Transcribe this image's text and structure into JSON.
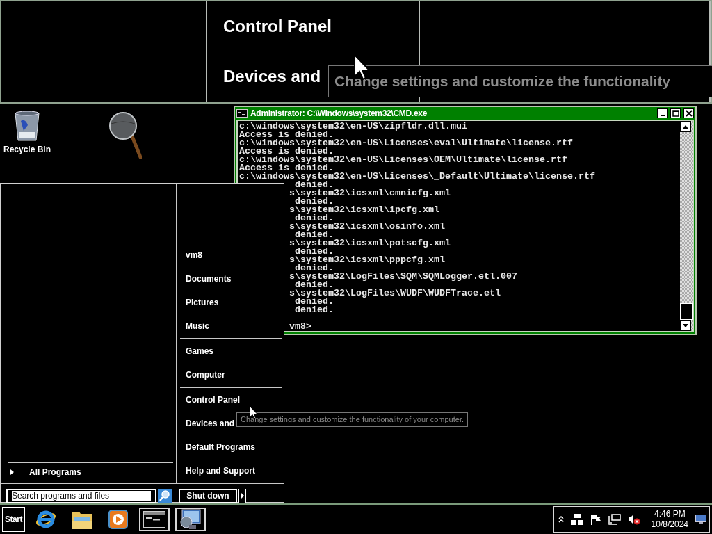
{
  "magnifier": {
    "items": [
      "Control Panel",
      "Devices and"
    ],
    "tooltip": "Change settings and customize the functionality"
  },
  "desktop_icons": [
    {
      "kind": "recycle-bin",
      "label": "Recycle Bin"
    },
    {
      "kind": "magnifier"
    }
  ],
  "cmd_window": {
    "title": "Administrator: C:\\Windows\\system32\\CMD.exe",
    "lines": [
      {
        "kind": "full",
        "text": "c:\\windows\\system32\\en-US\\zipfldr.dll.mui"
      },
      {
        "kind": "full",
        "text": "Access is denied."
      },
      {
        "kind": "full",
        "text": "c:\\windows\\system32\\en-US\\Licenses\\eval\\Ultimate\\license.rtf"
      },
      {
        "kind": "full",
        "text": "Access is denied."
      },
      {
        "kind": "full",
        "text": "c:\\windows\\system32\\en-US\\Licenses\\OEM\\Ultimate\\license.rtf"
      },
      {
        "kind": "full",
        "text": "Access is denied."
      },
      {
        "kind": "full",
        "text": "c:\\windows\\system32\\en-US\\Licenses\\_Default\\Ultimate\\license.rtf"
      },
      {
        "kind": "clipped",
        "text": " denied."
      },
      {
        "kind": "clipped",
        "text": "s\\system32\\icsxml\\cmnicfg.xml"
      },
      {
        "kind": "clipped",
        "text": " denied."
      },
      {
        "kind": "clipped",
        "text": "s\\system32\\icsxml\\ipcfg.xml"
      },
      {
        "kind": "clipped",
        "text": " denied."
      },
      {
        "kind": "clipped",
        "text": "s\\system32\\icsxml\\osinfo.xml"
      },
      {
        "kind": "clipped",
        "text": " denied."
      },
      {
        "kind": "clipped",
        "text": "s\\system32\\icsxml\\potscfg.xml"
      },
      {
        "kind": "clipped",
        "text": " denied."
      },
      {
        "kind": "clipped",
        "text": "s\\system32\\icsxml\\pppcfg.xml"
      },
      {
        "kind": "clipped",
        "text": " denied."
      },
      {
        "kind": "clipped",
        "text": "s\\system32\\LogFiles\\SQM\\SQMLogger.etl.007"
      },
      {
        "kind": "clipped",
        "text": " denied."
      },
      {
        "kind": "clipped",
        "text": "s\\system32\\LogFiles\\WUDF\\WUDFTrace.etl"
      },
      {
        "kind": "clipped",
        "text": " denied."
      },
      {
        "kind": "clipped",
        "text": " denied."
      },
      {
        "kind": "prompt",
        "text": "vm8>"
      }
    ]
  },
  "start_menu": {
    "place_groups": [
      [
        "vm8",
        "Documents",
        "Pictures",
        "Music"
      ],
      [
        "Games",
        "Computer"
      ],
      [
        "Control Panel",
        "Devices and",
        "Default Programs",
        "Help and Support"
      ]
    ],
    "all_programs": "All Programs",
    "search": {
      "placeholder": "Search programs and files"
    },
    "shutdown": "Shut down"
  },
  "tooltip": "Change settings and customize the functionality of your computer.",
  "taskbar": {
    "start": "Start",
    "items": [
      {
        "kind": "browser",
        "open": false
      },
      {
        "kind": "folder",
        "open": false
      },
      {
        "kind": "media",
        "open": false
      },
      {
        "kind": "console",
        "open": true
      },
      {
        "kind": "remote",
        "open": true
      }
    ],
    "tray": {
      "time": "4:46 PM",
      "date": "10/8/2024"
    }
  }
}
